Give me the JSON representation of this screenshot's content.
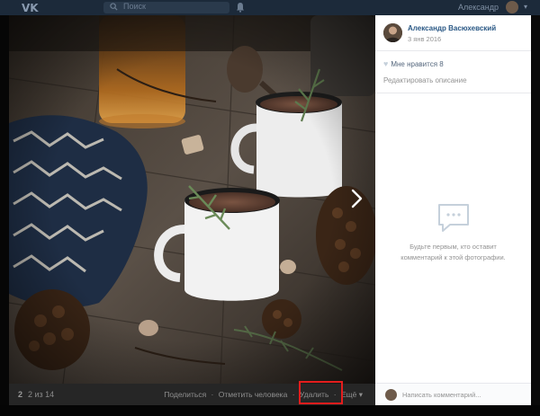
{
  "header": {
    "logo_icon": "vk-logo-icon",
    "search_placeholder": "Поиск",
    "user_name": "Александр"
  },
  "photo": {
    "number": "2",
    "count_text": "2 из 14",
    "actions": {
      "share": "Поделиться",
      "tag": "Отметить человека",
      "delete": "Удалить",
      "more": "Ещё"
    },
    "highlight_color": "#e41d1d"
  },
  "panel": {
    "author_name": "Александр Васюхевский",
    "date": "3 янв 2016",
    "likes_label": "Мне нравится",
    "likes_count": "8",
    "edit_description": "Редактировать описание",
    "empty_comments_line1": "Будьте первым, кто оставит",
    "empty_comments_line2": "комментарий к этой фотографии.",
    "comment_placeholder": "Написать комментарий..."
  },
  "colors": {
    "link": "#2a5885",
    "muted": "#939393",
    "photo_bar": "#262626"
  }
}
